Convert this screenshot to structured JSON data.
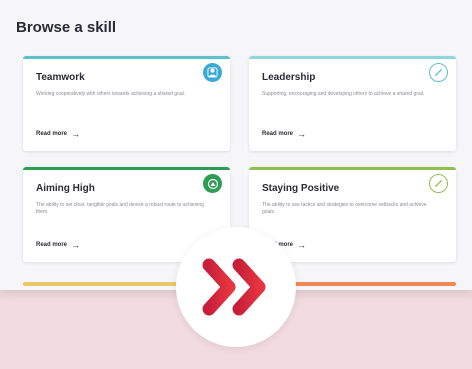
{
  "page": {
    "title": "Browse a skill"
  },
  "colors": {
    "accent": "#d7273c",
    "band": "#f2dbe1",
    "teamwork": "#5cc1cc",
    "aiming_high": "#2e9c53",
    "staying_positive": "#8cc151"
  },
  "cards": [
    {
      "title": "Teamwork",
      "description": "Working cooperatively with others towards achieving a shared goal.",
      "link": "Read more",
      "icon": "teamwork-icon"
    },
    {
      "title": "Leadership",
      "description": "Supporting, encouraging and developing others to achieve a shared goal.",
      "link": "Read more",
      "icon": "compass-icon"
    },
    {
      "title": "Aiming High",
      "description": "The ability to set clear, tangible goals and devise a robust route to achieving them.",
      "link": "Read more",
      "icon": "target-icon"
    },
    {
      "title": "Staying Positive",
      "description": "The ability to use tactics and strategies to overcome setbacks and achieve goals.",
      "link": "Read more",
      "icon": "compass-icon"
    }
  ],
  "next_button": {
    "icon": "double-chevron-right-icon"
  }
}
